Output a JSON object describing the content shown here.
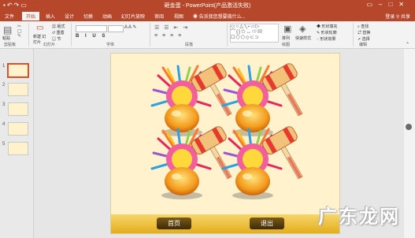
{
  "window": {
    "title": "砸金蛋 - PowerPoint(产品激活失败)",
    "qat_icons": [
      "save-icon",
      "undo-icon",
      "redo-icon",
      "present-icon"
    ]
  },
  "tabs": [
    {
      "label": "文件"
    },
    {
      "label": "开始",
      "active": true
    },
    {
      "label": "插入"
    },
    {
      "label": "设计"
    },
    {
      "label": "切换"
    },
    {
      "label": "动画"
    },
    {
      "label": "幻灯片放映"
    },
    {
      "label": "审阅"
    },
    {
      "label": "视图"
    }
  ],
  "tell_me": "告诉我您想要做什么...",
  "account": {
    "login": "登录",
    "share": "共享"
  },
  "ribbon": {
    "paste": "粘贴",
    "new_slide": "新建 幻灯片",
    "layout": "版式",
    "reset": "重置",
    "section": "节",
    "arrange": "排列",
    "quick_styles": "快速样式",
    "shape_fill": "形状填充",
    "shape_outline": "形状轮廓",
    "shape_effects": "形状效果",
    "find": "查找",
    "replace": "替换",
    "select": "选择",
    "groups": {
      "clipboard": "剪贴板",
      "slides": "幻灯片",
      "font": "字体",
      "paragraph": "段落",
      "drawing": "绘图",
      "editing": "编辑"
    },
    "format_buttons": "B I U S"
  },
  "thumbnails": [
    {
      "num": "1"
    },
    {
      "num": "2"
    },
    {
      "num": "3"
    },
    {
      "num": "4"
    },
    {
      "num": "5"
    }
  ],
  "slide": {
    "buttons": {
      "home": "首页",
      "exit": "退出"
    }
  },
  "watermark": "广东龙网",
  "colors": {
    "accent": "#b7472a",
    "slide_bg": "#fff2cc",
    "footer_bar": "#e4ad1c",
    "button": "#4a330b"
  }
}
